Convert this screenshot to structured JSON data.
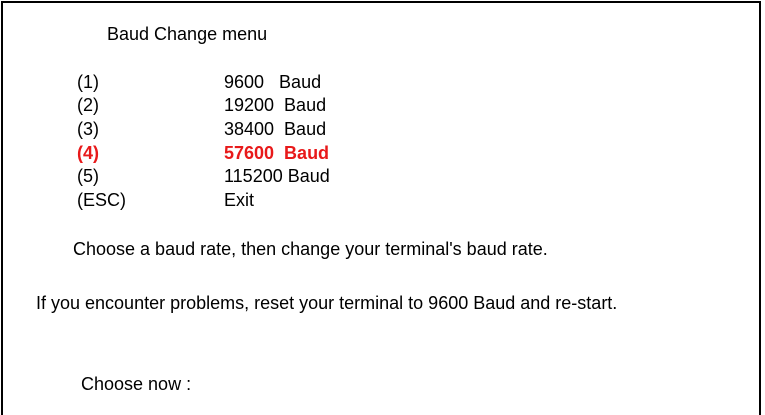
{
  "title": "Baud Change menu",
  "menu": {
    "items": [
      {
        "key": "(1)",
        "label": "9600   Baud",
        "selected": false
      },
      {
        "key": "(2)",
        "label": "19200  Baud",
        "selected": false
      },
      {
        "key": "(3)",
        "label": "38400  Baud",
        "selected": false
      },
      {
        "key": "(4)",
        "label": "57600  Baud",
        "selected": true
      },
      {
        "key": "(5)",
        "label": "115200 Baud",
        "selected": false
      },
      {
        "key": "(ESC)",
        "label": "Exit",
        "selected": false
      }
    ]
  },
  "instructions": {
    "choose": "Choose a baud rate, then change your terminal's baud rate.",
    "problems": "If you encounter problems, reset your terminal to 9600 Baud and re-start."
  },
  "prompt": {
    "label": "Choose now :"
  },
  "colors": {
    "selected": "#e8191a",
    "text": "#000000",
    "background": "#ffffff"
  }
}
